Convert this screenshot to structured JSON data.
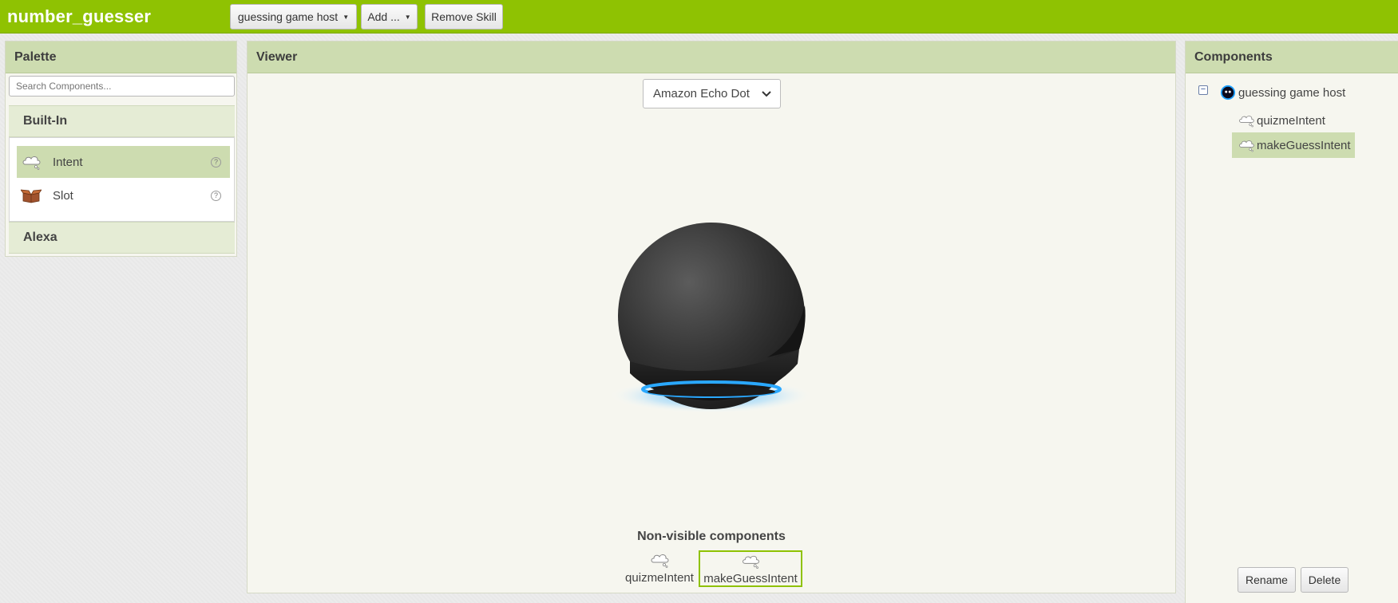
{
  "app": {
    "title": "number_guesser"
  },
  "toolbar": {
    "screen_select": "guessing game host",
    "add_label": "Add ...",
    "remove_label": "Remove Skill"
  },
  "palette": {
    "header": "Palette",
    "search_placeholder": "Search Components...",
    "categories": [
      {
        "label": "Built-In",
        "expanded": true
      },
      {
        "label": "Alexa",
        "expanded": false
      }
    ],
    "items": [
      {
        "label": "Intent",
        "icon": "thought-cloud-icon",
        "help": "?",
        "selected": true
      },
      {
        "label": "Slot",
        "icon": "open-box-icon",
        "help": "?",
        "selected": false
      }
    ]
  },
  "viewer": {
    "header": "Viewer",
    "device": "Amazon Echo Dot",
    "device_image": "echo-dot-speaker",
    "nonvisible_title": "Non-visible components",
    "nonvisible_items": [
      {
        "label": "quizmeIntent",
        "icon": "thought-cloud-icon",
        "selected": false
      },
      {
        "label": "makeGuessIntent",
        "icon": "thought-cloud-icon",
        "selected": true
      }
    ]
  },
  "components": {
    "header": "Components",
    "toggle": "−",
    "tree": [
      {
        "label": "guessing game host",
        "icon": "alexa-avatar-icon",
        "level": 0
      },
      {
        "label": "quizmeIntent",
        "icon": "thought-cloud-icon",
        "level": 1,
        "selected": false
      },
      {
        "label": "makeGuessIntent",
        "icon": "thought-cloud-icon",
        "level": 1,
        "selected": true
      }
    ],
    "rename_label": "Rename",
    "delete_label": "Delete"
  },
  "colors": {
    "topbar": "#8fc202",
    "panel_header": "#cddcb0",
    "selection": "#cddcb0",
    "accent_ring": "#1ea1ff"
  }
}
